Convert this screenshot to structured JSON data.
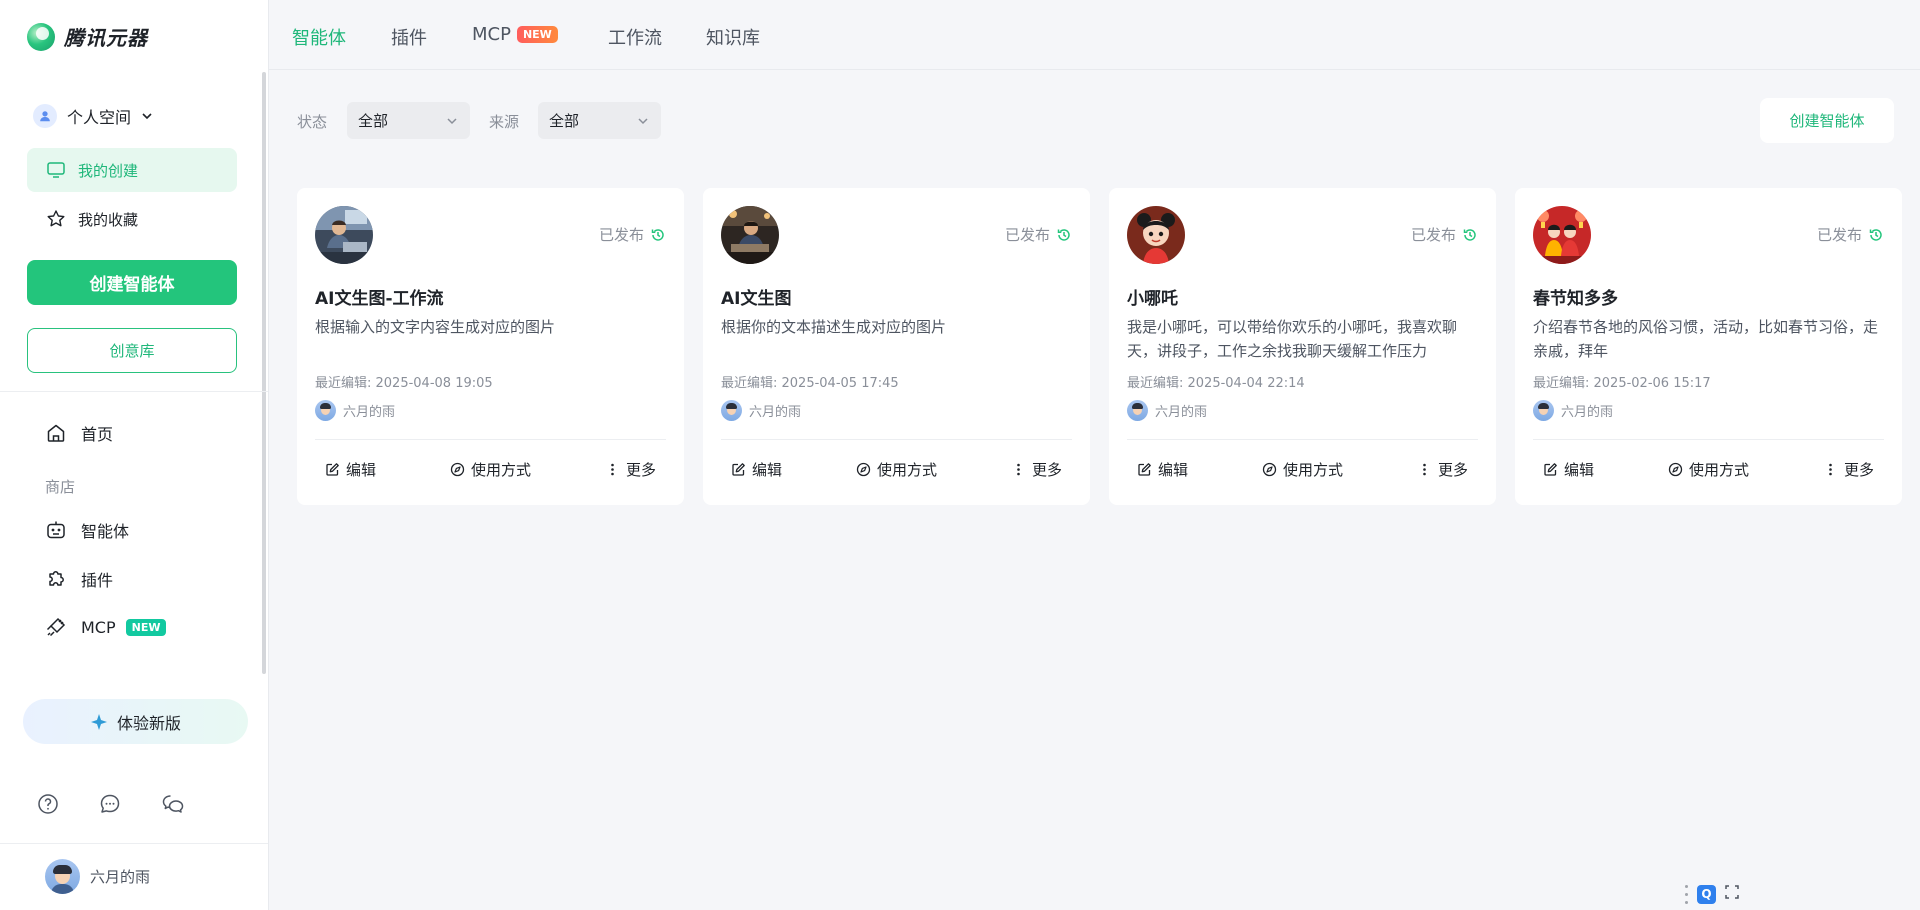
{
  "app": {
    "name": "腾讯元器"
  },
  "sidebar": {
    "space_label": "个人空间",
    "nav": [
      {
        "label": "我的创建",
        "active": true
      },
      {
        "label": "我的收藏",
        "active": false
      }
    ],
    "create_button": "创建智能体",
    "idea_button": "创意库",
    "home_label": "首页",
    "store_section": "商店",
    "store_items": [
      {
        "label": "智能体"
      },
      {
        "label": "插件"
      },
      {
        "label": "MCP",
        "badge": "NEW"
      }
    ],
    "try_new": "体验新版",
    "tools": [
      "help-icon",
      "message-icon",
      "chat-icon"
    ],
    "user_name": "六月的雨"
  },
  "topbar": {
    "tabs": [
      {
        "label": "智能体",
        "active": true
      },
      {
        "label": "插件"
      },
      {
        "label": "MCP",
        "badge": "NEW"
      },
      {
        "label": "工作流"
      },
      {
        "label": "知识库"
      }
    ]
  },
  "filters": {
    "status_label": "状态",
    "status_value": "全部",
    "source_label": "来源",
    "source_value": "全部",
    "create_button": "创建智能体"
  },
  "cards": [
    {
      "status": "已发布",
      "title": "AI文生图-工作流",
      "desc": "根据输入的文字内容生成对应的图片",
      "time": "最近编辑: 2025-04-08 19:05",
      "author": "六月的雨"
    },
    {
      "status": "已发布",
      "title": "AI文生图",
      "desc": "根据你的文本描述生成对应的图片",
      "time": "最近编辑: 2025-04-05 17:45",
      "author": "六月的雨"
    },
    {
      "status": "已发布",
      "title": "小哪吒",
      "desc": "我是小哪吒，可以带给你欢乐的小哪吒，我喜欢聊天，讲段子，工作之余找我聊天缓解工作压力",
      "time": "最近编辑: 2025-04-04 22:14",
      "author": "六月的雨"
    },
    {
      "status": "已发布",
      "title": "春节知多多",
      "desc": "介绍春节各地的风俗习惯，活动，比如春节习俗，走亲戚，拜年",
      "time": "最近编辑: 2025-02-06 15:17",
      "author": "六月的雨"
    }
  ],
  "card_actions": {
    "edit": "编辑",
    "usage": "使用方式",
    "more": "更多"
  },
  "floaters": {
    "q_label": "Q"
  },
  "colors": {
    "accent": "#23c57c",
    "accent_text": "#1fb77a",
    "background": "#f5f6f9"
  }
}
